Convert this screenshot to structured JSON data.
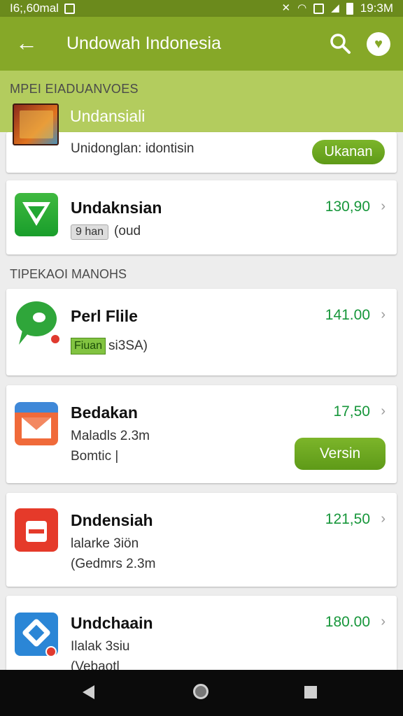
{
  "status_bar": {
    "left_text": "I6;,60mal",
    "time": "19:3M"
  },
  "app_bar": {
    "title": "Undowah Indonesia",
    "back_icon": "back-arrow-icon",
    "search_icon": "search-icon",
    "favorite_icon": "heart-icon"
  },
  "featured": {
    "section_label": "MPEI EIADUANVOES",
    "title": "Undansiali",
    "subtitle": "Unidonglan: idontisin",
    "button_label": "Ukanan"
  },
  "section2": {
    "label": "TIPEKAOI MANOHS"
  },
  "apps": [
    {
      "name": "Undaknsian",
      "price": "130,90",
      "badge": "9 han",
      "line1_text": "(oud",
      "icon": "checkmark-icon"
    },
    {
      "name": "Perl Flile",
      "price": "141.00",
      "badge": "Fiuan",
      "line1_text": "si3SA)",
      "icon": "chat-bubble-icon"
    },
    {
      "name": "Bedakan",
      "price": "17,50",
      "line1": "Maladls 2.3m",
      "line2": "Bomtic |",
      "button_label": "Versin",
      "icon": "mail-icon"
    },
    {
      "name": "Dndensiah",
      "price": "121,50",
      "line1": "lalarke 3iön",
      "line2": "(Gedmrs 2.3m",
      "icon": "calendar-icon"
    },
    {
      "name": "Undchaain",
      "price": "180.00",
      "line1": "Ilalak 3siu",
      "line2": "(Vebaotl",
      "icon": "pin-icon"
    }
  ],
  "colors": {
    "status_bar": "#6b8a1c",
    "app_bar": "#86a828",
    "featured_band": "#b3cc5e",
    "price_green": "#16963a",
    "button_green": "#6aa822"
  }
}
